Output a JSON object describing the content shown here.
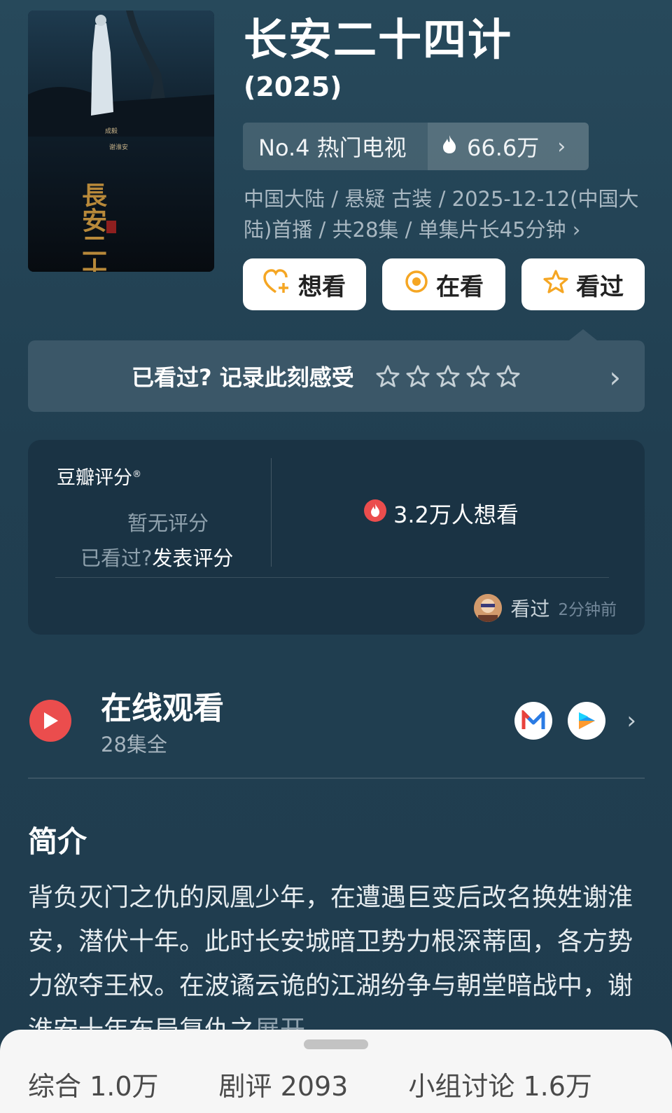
{
  "show": {
    "title": "长安二十四计",
    "year": "(2025)",
    "rank_label": "No.4 热门电视",
    "heat": "66.6万",
    "meta": "中国大陆 / 悬疑 古装 / 2025-12-12(中国大陆)首播 / 共28集 / 单集片长45分钟",
    "poster_text": {
      "cast1": "成毅",
      "cast2": "谢淮安",
      "calligraphy": "長安二十四計"
    }
  },
  "actions": {
    "want": "想看",
    "watching": "在看",
    "watched": "看过"
  },
  "rate_prompt": "已看过? 记录此刻感受",
  "score": {
    "label": "豆瓣评分",
    "reg": "®",
    "no_score": "暂无评分",
    "seen_q": "已看过?",
    "post_link": "发表评分",
    "want_count": "3.2万人想看",
    "activity_verb": "看过",
    "activity_time": "2分钟前"
  },
  "watch": {
    "title": "在线观看",
    "episodes": "28集全",
    "apps": [
      "mango-tv-icon",
      "youku-icon"
    ]
  },
  "intro": {
    "heading": "简介",
    "text": "背负灭门之仇的凤凰少年，在遭遇巨变后改名换姓谢淮安，潜伏十年。此时长安城暗卫势力根深蒂固，各方势力欲夺王权。在波谲云诡的江湖纷争与朝堂暗战中，谢淮安十年布局复仇之",
    "expand": "展开"
  },
  "bottom_tabs": [
    {
      "label": "综合",
      "count": "1.0万"
    },
    {
      "label": "剧评",
      "count": "2093"
    },
    {
      "label": "小组讨论",
      "count": "1.6万"
    }
  ],
  "colors": {
    "background": "#1e3a4c",
    "accent_red": "#eb4d4d",
    "star_orange": "#f5a623"
  }
}
